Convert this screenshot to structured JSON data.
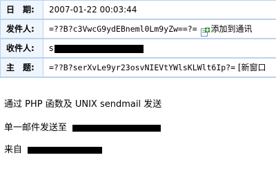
{
  "header": {
    "date": {
      "label": "日　期:",
      "value": "2007-01-22 00:03:44"
    },
    "from": {
      "label": "发件人:",
      "value": "=??B?c3VwcG9ydEBneml0Lm9yZw==?=",
      "action": "添加到通讯"
    },
    "to": {
      "label": "收件人:",
      "value": "s"
    },
    "subject": {
      "label": "主　题:",
      "value": "=??B?serXvLe9yr23osvNIEVtYWlsKLWlt6Ip?=",
      "action": "[新窗口"
    }
  },
  "body": {
    "line1": "通过 PHP 函数及 UNIX sendmail 发送",
    "line2": "单一邮件发送至",
    "line3": "来自"
  },
  "icons": {
    "add_contact": "add-contact-icon"
  },
  "colors": {
    "header_border": "#b9d2ee",
    "label_bg": "#eef5fd",
    "icon_green": "#3a9a2c"
  }
}
